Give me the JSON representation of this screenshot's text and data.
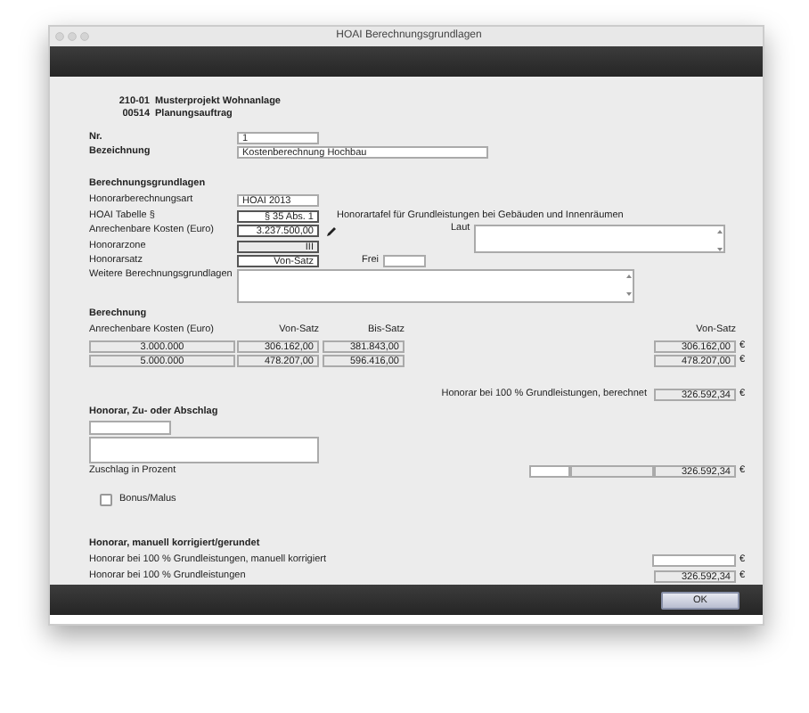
{
  "window": {
    "title": "HOAI Berechnungsgrundlagen"
  },
  "header": [
    {
      "code": "210-01",
      "name": "Musterprojekt Wohnanlage"
    },
    {
      "code": "00514",
      "name": "Planungsauftrag"
    }
  ],
  "nr": {
    "label": "Nr.",
    "value": "1"
  },
  "bezeichnung": {
    "label": "Bezeichnung",
    "value": "Kostenberechnung Hochbau"
  },
  "basis": {
    "title": "Berechnungsgrundlagen",
    "art": {
      "label": "Honorarberechnungsart",
      "value": "HOAI 2013"
    },
    "tabelle": {
      "label": "HOAI Tabelle §",
      "value": "§ 35 Abs. 1",
      "note": "Honorartafel für Grundleistungen bei Gebäuden und Innenräumen"
    },
    "kosten": {
      "label": "Anrechenbare Kosten (Euro)",
      "value": "3.237.500,00",
      "laut_label": "Laut"
    },
    "zone": {
      "label": "Honorarzone",
      "value": "III"
    },
    "satz": {
      "label": "Honorarsatz",
      "value": "Von-Satz",
      "frei_label": "Frei"
    },
    "weitere": {
      "label": "Weitere Berechnungsgrundlagen"
    }
  },
  "berechnung": {
    "title": "Berechnung",
    "columns": [
      "Anrechenbare Kosten (Euro)",
      "Von-Satz",
      "Bis-Satz",
      "Von-Satz"
    ],
    "rows": [
      {
        "kosten": "3.000.000",
        "von": "306.162,00",
        "bis": "381.843,00",
        "result": "306.162,00",
        "currency": "€"
      },
      {
        "kosten": "5.000.000",
        "von": "478.207,00",
        "bis": "596.416,00",
        "result": "478.207,00",
        "currency": "€"
      }
    ],
    "total_label": "Honorar bei 100 % Grundleistungen, berechnet",
    "total": "326.592,34",
    "total_currency": "€"
  },
  "zuschlag": {
    "title": "Honorar, Zu- oder Abschlag",
    "percent_label": "Zuschlag in Prozent",
    "value": "326.592,34",
    "currency": "€"
  },
  "bonus": {
    "label": "Bonus/Malus",
    "checked": false
  },
  "manuell": {
    "title": "Honorar, manuell korrigiert/gerundet",
    "korrigiert_label": "Honorar bei 100 % Grundleistungen, manuell korrigiert",
    "korrigiert_currency": "€",
    "final_label": "Honorar bei 100 % Grundleistungen",
    "final_value": "326.592,34",
    "final_currency": "€"
  },
  "buttons": [
    {
      "label": "OK"
    }
  ]
}
